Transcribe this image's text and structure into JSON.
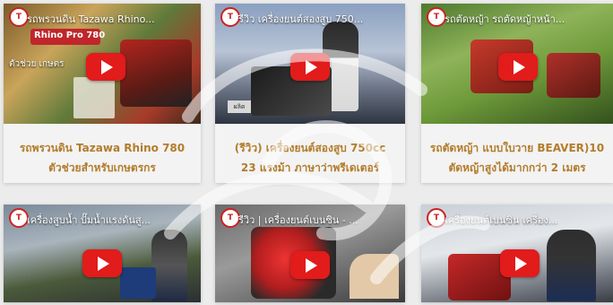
{
  "videos": [
    {
      "title": "รถพรวนดิน Tazawa Rhino...",
      "caption1": "รถพรวนดิน Tazawa Rhino 780",
      "caption2": "ตัวช่วยสำหรับเกษตรกร",
      "overlay_brand": "Rhino Pro 780",
      "overlay_text": "ตัวช่วย เกษตร"
    },
    {
      "title": "รีวิว เครื่องยนต์สองสูบ 750...",
      "caption1": "(รีวิว) เครื่องยนต์สองสูบ 750cc",
      "caption2": "23 แรงม้า ภาษาว่าพรีเดเตอร์",
      "overlay_brand": "",
      "overlay_text": ""
    },
    {
      "title": "รถตัดหญ้า รถตัดหญ้าหน้า...",
      "caption1": "รถตัดหญ้า แบบใบวาย BEAVER)10",
      "caption2": "ตัดหญ้าสูงได้มากกว่า 2 เมตร",
      "overlay_brand": "",
      "overlay_text": ""
    },
    {
      "title": "เครื่องสูบน้ำ ปั๊มน้ำแรงดันสู...",
      "caption1": "",
      "caption2": "",
      "overlay_brand": "",
      "overlay_text": ""
    },
    {
      "title": "รีวิว | เครื่องยนต์เบนซิน - ...",
      "caption1": "",
      "caption2": "",
      "overlay_brand": "",
      "overlay_text": ""
    },
    {
      "title": "เครื่องยนต์เบนซิน เครื่อง...",
      "caption1": "",
      "caption2": "",
      "overlay_brand": "",
      "overlay_text": ""
    }
  ],
  "colors": {
    "play_button": "#e21b1b",
    "caption_text": "#b37c2c",
    "page_bg": "#ececec"
  }
}
